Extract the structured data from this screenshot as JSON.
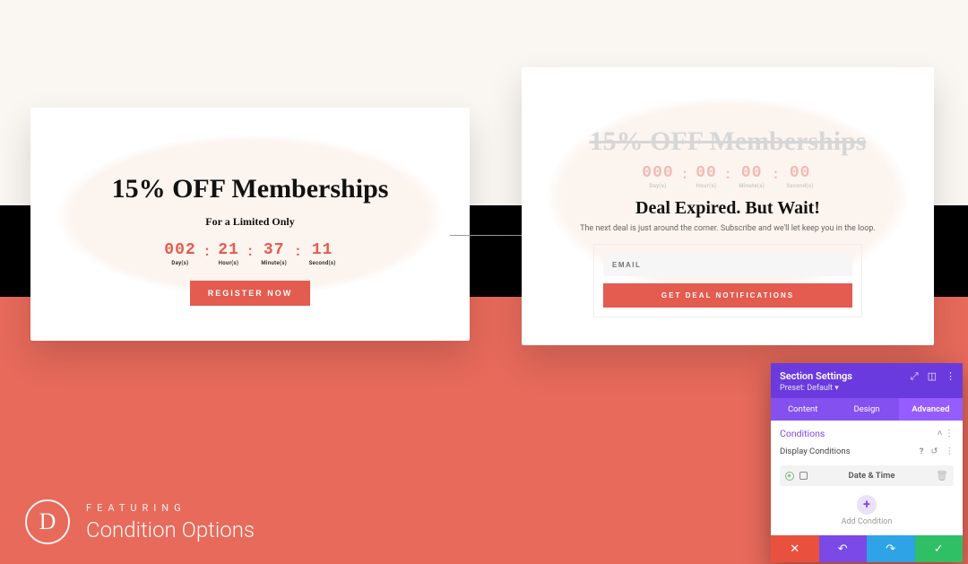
{
  "colors": {
    "accent": "#e45b4f",
    "bg_red": "#e76a5b",
    "panel_purple": "#6b3adf"
  },
  "cardA": {
    "title": "15% OFF Memberships",
    "subtitle": "For a Limited Only",
    "timer": {
      "days": {
        "value": "002",
        "label": "Day(s)"
      },
      "hours": {
        "value": "21",
        "label": "Hour(s)"
      },
      "minutes": {
        "value": "37",
        "label": "Minute(s)"
      },
      "seconds": {
        "value": "11",
        "label": "Second(s)"
      }
    },
    "cta": "REGISTER NOW"
  },
  "cardB": {
    "title_struck": "15% OFF Memberships",
    "timer": {
      "days": {
        "value": "000",
        "label": "Day(s)"
      },
      "hours": {
        "value": "00",
        "label": "Hour(s)"
      },
      "minutes": {
        "value": "00",
        "label": "Minute(s)"
      },
      "seconds": {
        "value": "00",
        "label": "Second(s)"
      }
    },
    "headline": "Deal Expired. But Wait!",
    "description": "The next deal is just around the corner. Subscribe and we'll let keep you in the loop.",
    "email_placeholder": "EMAIL",
    "cta": "GET DEAL NOTIFICATIONS"
  },
  "feature": {
    "logo_letter": "D",
    "kicker": "FEATURING",
    "title": "Condition Options"
  },
  "panel": {
    "title": "Section Settings",
    "preset": "Preset: Default",
    "tabs": {
      "content": "Content",
      "design": "Design",
      "advanced": "Advanced"
    },
    "section": "Conditions",
    "row_label": "Display Conditions",
    "condition_label": "Date & Time",
    "add_label": "Add Condition"
  }
}
